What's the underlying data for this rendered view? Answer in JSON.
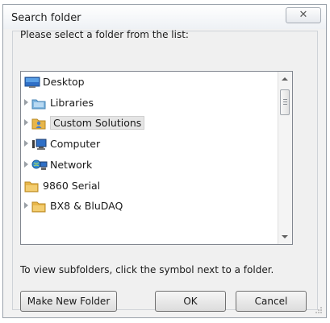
{
  "window": {
    "title": "Search folder",
    "close_glyph": "✕"
  },
  "prompt": "Please select a folder from the list:",
  "tree": {
    "items": [
      {
        "label": "Desktop",
        "icon": "desktop-icon",
        "expander": false,
        "selected": false
      },
      {
        "label": "Libraries",
        "icon": "libraries-icon",
        "expander": true,
        "selected": false
      },
      {
        "label": "Custom Solutions",
        "icon": "user-folder-icon",
        "expander": true,
        "selected": true
      },
      {
        "label": "Computer",
        "icon": "computer-icon",
        "expander": true,
        "selected": false
      },
      {
        "label": "Network",
        "icon": "network-icon",
        "expander": true,
        "selected": false
      },
      {
        "label": "9860 Serial",
        "icon": "folder-icon",
        "expander": false,
        "selected": false
      },
      {
        "label": "BX8 & BluDAQ",
        "icon": "folder-icon",
        "expander": true,
        "selected": false
      }
    ]
  },
  "hint": "To view subfolders, click the symbol next to a folder.",
  "buttons": {
    "make_new_folder": "Make New Folder",
    "ok": "OK",
    "cancel": "Cancel"
  },
  "colors": {
    "folder": "#e8b64a",
    "selection": "#e5e5e5",
    "border": "#828790"
  }
}
